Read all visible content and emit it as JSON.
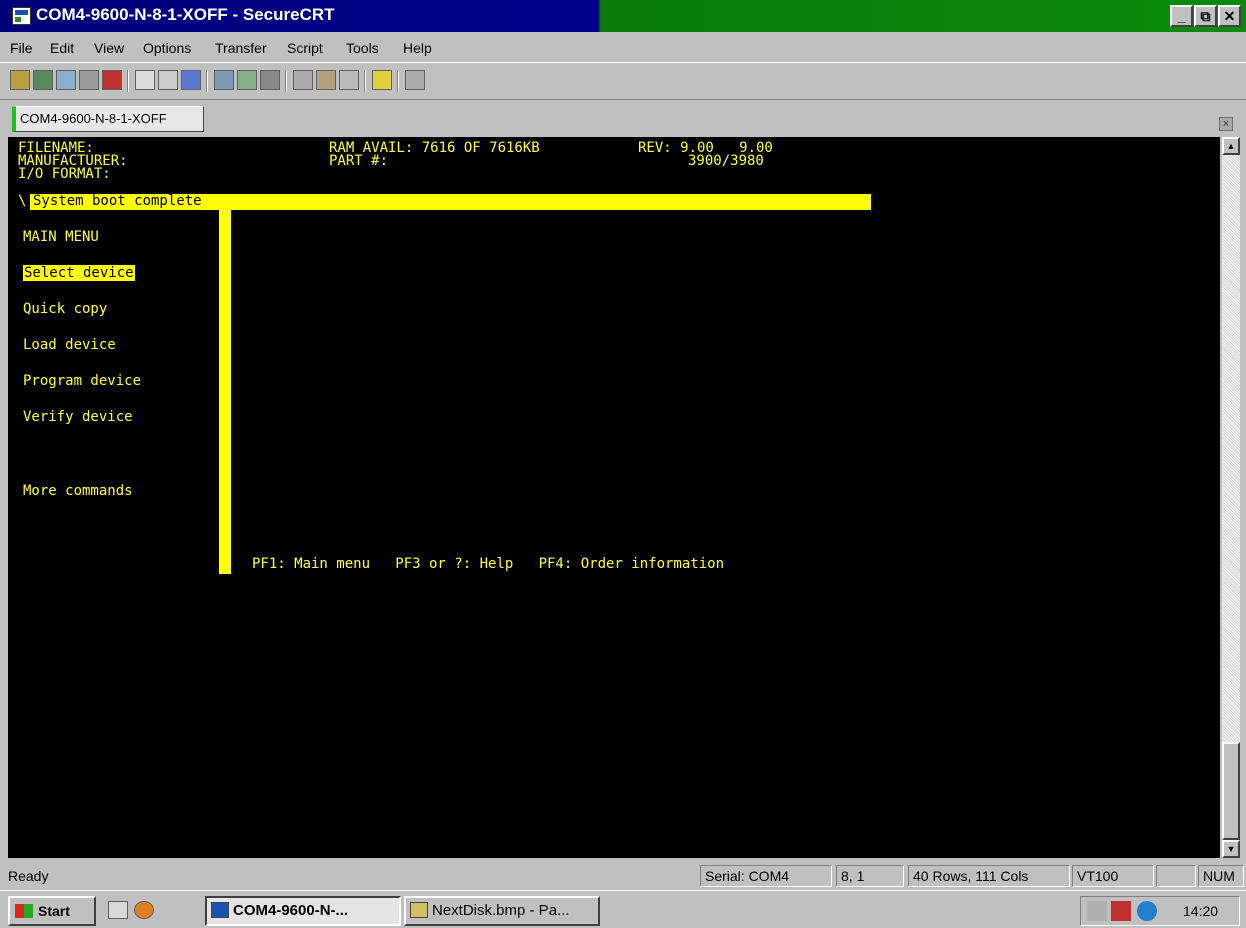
{
  "window": {
    "title": "COM4-9600-N-8-1-XOFF - SecureCRT",
    "min": "_",
    "max": "⧉",
    "close": "✕"
  },
  "menu": [
    "File",
    "Edit",
    "View",
    "Options",
    "Transfer",
    "Script",
    "Tools",
    "Help"
  ],
  "tab": {
    "label": "COM4-9600-N-8-1-XOFF",
    "close": "×"
  },
  "terminal": {
    "filename_label": "FILENAME:",
    "manufacturer_label": "MANUFACTURER:",
    "io_format_label": "I/O FORMAT:",
    "ram_label": "RAM AVAIL: 7616 OF 7616KB",
    "rev_label": "REV: 9.00   9.00",
    "part_label": "PART #:",
    "part_value": "3900/3980",
    "boot_prefix": "\\",
    "boot_message": "System boot complete",
    "main_menu_title": "MAIN MENU",
    "options": [
      "Select device",
      "Quick copy",
      "Load device",
      "Program device",
      "Verify device",
      "More commands"
    ],
    "footer": "PF1: Main menu   PF3 or ?: Help   PF4: Order information"
  },
  "status": {
    "text": "Ready",
    "serial": "Serial: COM4",
    "position": "8,  1",
    "size": "40 Rows, 111 Cols",
    "emulation": "VT100",
    "empty": "",
    "num": "NUM"
  },
  "taskbar": {
    "start": "Start",
    "tasks": [
      "COM4-9600-N-...",
      "NextDisk.bmp - Pa..."
    ],
    "clock": "14:20"
  },
  "colors": {
    "terminal_text": "#ffff33",
    "terminal_bg": "#000000",
    "highlight": "#ffff00",
    "title_blue": "#00007a",
    "title_green": "#0a8a0a"
  }
}
